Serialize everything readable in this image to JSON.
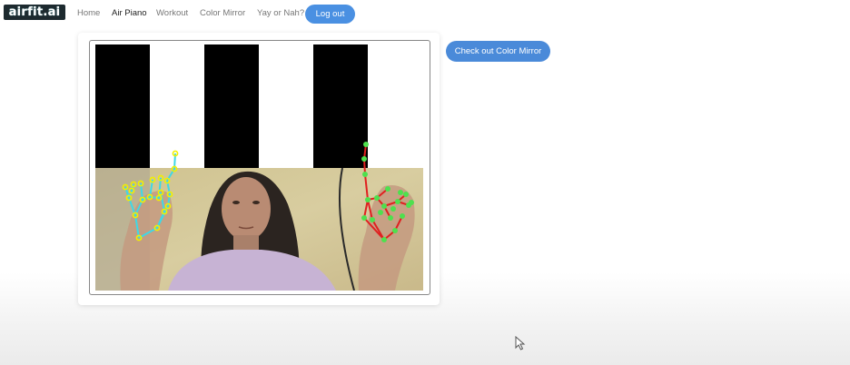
{
  "navbar": {
    "logo": "airfit.ai",
    "links": [
      "Home",
      "Air Piano",
      "Workout",
      "Color Mirror",
      "Yay or Nah?"
    ],
    "active": "Air Piano",
    "logout_label": "Log out"
  },
  "main": {
    "cta_label": "Check out Color Mirror"
  },
  "colors": {
    "accent": "#4a90e2",
    "left_hand_landmarks": "#f0f000",
    "left_hand_connections": "#3fd8e6",
    "right_hand_landmarks": "#4ee04e",
    "right_hand_connections": "#e02020"
  },
  "icons": [
    "mouse-cursor-icon"
  ]
}
